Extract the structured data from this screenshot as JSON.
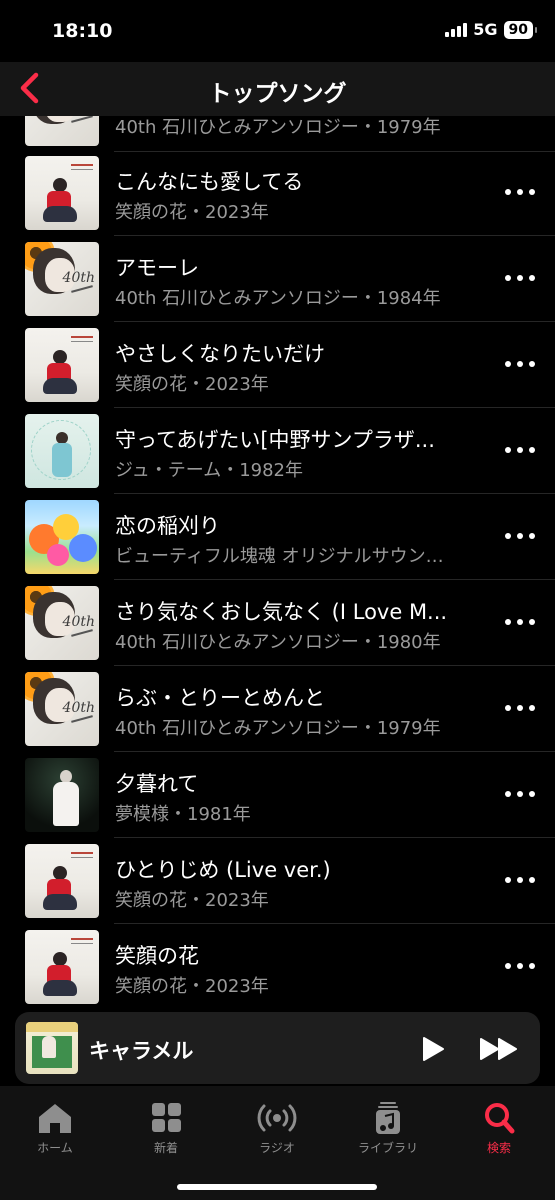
{
  "status": {
    "time": "18:10",
    "network": "5G",
    "battery": "90"
  },
  "header": {
    "title": "トップソング",
    "back_icon": "chevron-left-icon"
  },
  "songs": [
    {
      "title": "",
      "subtitle": "40th 石川ひとみアンソロジー・1979年",
      "art": "anthology-40th"
    },
    {
      "title": "こんなにも愛してる",
      "subtitle": "笑顔の花・2023年",
      "art": "egao-no-hana"
    },
    {
      "title": "アモーレ",
      "subtitle": "40th 石川ひとみアンソロジー・1984年",
      "art": "anthology-40th"
    },
    {
      "title": "やさしくなりたいだけ",
      "subtitle": "笑顔の花・2023年",
      "art": "egao-no-hana"
    },
    {
      "title": "守ってあげたい[中野サンプラザ...",
      "subtitle": "ジュ・テーム・1982年",
      "art": "je-taime"
    },
    {
      "title": "恋の稲刈り",
      "subtitle": "ビューティフル塊魂 オリジナルサウン…",
      "art": "katamari"
    },
    {
      "title": "さり気なくおし気なく (I Love M...",
      "subtitle": "40th 石川ひとみアンソロジー・1980年",
      "art": "anthology-40th"
    },
    {
      "title": "らぶ・とりーとめんと",
      "subtitle": "40th 石川ひとみアンソロジー・1979年",
      "art": "anthology-40th"
    },
    {
      "title": "夕暮れて",
      "subtitle": "夢模様・1981年",
      "art": "yume-moyou"
    },
    {
      "title": "ひとりじめ (Live ver.)",
      "subtitle": "笑顔の花・2023年",
      "art": "egao-no-hana"
    },
    {
      "title": "笑顔の花",
      "subtitle": "笑顔の花・2023年",
      "art": "egao-no-hana"
    }
  ],
  "player": {
    "title": "キャラメル",
    "play_icon": "play-icon",
    "forward_icon": "fast-forward-icon"
  },
  "tabs": [
    {
      "label": "ホーム",
      "icon": "home-icon"
    },
    {
      "label": "新着",
      "icon": "grid-icon"
    },
    {
      "label": "ラジオ",
      "icon": "radio-icon"
    },
    {
      "label": "ライブラリ",
      "icon": "library-icon"
    },
    {
      "label": "検索",
      "icon": "search-icon",
      "active": true
    }
  ],
  "colors": {
    "accent": "#fa2d48",
    "background": "#000000",
    "secondary_text": "#9a9a9a"
  }
}
